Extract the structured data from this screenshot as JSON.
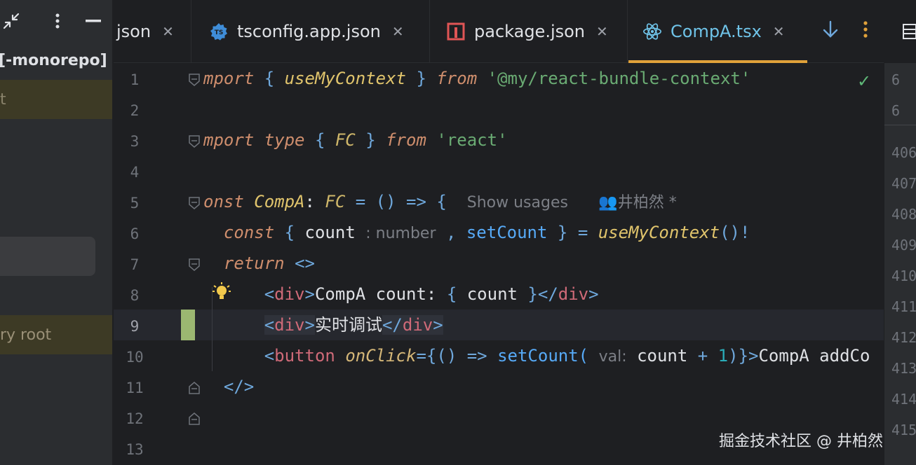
{
  "left_panel": {
    "project_label": "[-monorepo]",
    "row1_text": "t",
    "row3_text": "ry root",
    "icons": [
      "collapse-icon",
      "more-vert-icon",
      "minimize-icon"
    ]
  },
  "tabs": [
    {
      "label": "json",
      "icon": "json-icon",
      "closable": true
    },
    {
      "label": "tsconfig.app.json",
      "icon": "typescript-config-icon",
      "closable": true
    },
    {
      "label": "package.json",
      "icon": "npm-package-icon",
      "closable": true
    },
    {
      "label": "CompA.tsx",
      "icon": "react-icon",
      "closable": true,
      "active": true
    }
  ],
  "tabbar_actions": [
    "arrow-down-icon",
    "more-vert-icon"
  ],
  "accent_color": "#e0a13a",
  "editor": {
    "line_numbers": [
      "1",
      "2",
      "3",
      "4",
      "5",
      "6",
      "7",
      "8",
      "9",
      "10",
      "11",
      "12",
      "13"
    ],
    "active_line": "9",
    "lines": {
      "l1": {
        "kw": "mport",
        "ob": "{",
        "fn": "useMyContext",
        "cb": "}",
        "from": "from",
        "str": "'@my/react-bundle-context'"
      },
      "l3": {
        "kw": "mport",
        "kw2": "type",
        "ob": "{",
        "ty": "FC",
        "cb": "}",
        "from": "from",
        "str": "'react'"
      },
      "l5": {
        "kw": "onst",
        "name": "CompA",
        "colon": ":",
        "ty": "FC",
        "eq": "=",
        "arrow": "() => {",
        "hint_usages": "Show usages",
        "author": "井柏然 *"
      },
      "l6": {
        "kw": "const",
        "ob": "{",
        "var1": "count",
        "hint_type": ": number",
        "comma": ",",
        "var2": "setCount",
        "cb": "}",
        "eq": "=",
        "fn": "useMyContext",
        "tail": "()!"
      },
      "l7": {
        "kw": "return",
        "tag": "<>"
      },
      "l8": {
        "open_lt": "<",
        "open_name": "div",
        "open_gt": ">",
        "text": "CompA count: ",
        "ob": "{",
        "var": " count ",
        "cb": "}",
        "close_lt": "</",
        "close_name": "div",
        "close_gt": ">"
      },
      "l9": {
        "open_lt": "<",
        "open_name": "div",
        "open_gt": ">",
        "text": "实时调试",
        "close_lt": "</",
        "close_name": "div",
        "close_gt": ">"
      },
      "l10": {
        "open_lt": "<",
        "open_name": "button",
        "attr": "onClick",
        "eq": "={",
        "arrow": "() =>",
        "fn": "setCount(",
        "hint_param": "val:",
        "expr": "count",
        "plus": "+",
        "num": "1",
        "tail": ")}",
        "gt": ">",
        "text": "CompA addCo"
      },
      "l11": {
        "tag": "</>"
      }
    }
  },
  "right_panel_numbers": [
    "6",
    "6",
    "406",
    "407",
    "408",
    "409",
    "410",
    "411",
    "412",
    "413",
    "414",
    "415"
  ],
  "watermark": "掘金技术社区 @ 井柏然"
}
